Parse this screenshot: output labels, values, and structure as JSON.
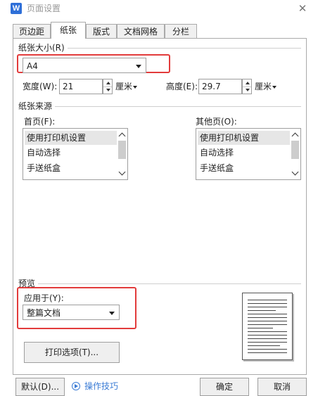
{
  "window": {
    "app_icon_letter": "W",
    "title": "页面设置",
    "close_glyph": "✕"
  },
  "tabs": [
    {
      "label": "页边距",
      "active": false
    },
    {
      "label": "纸张",
      "active": true
    },
    {
      "label": "版式",
      "active": false
    },
    {
      "label": "文档网格",
      "active": false
    },
    {
      "label": "分栏",
      "active": false
    }
  ],
  "paper_size": {
    "section_title": "纸张大小(R)",
    "selected": "A4",
    "width_label": "宽度(W):",
    "width_value": "21",
    "height_label": "高度(E):",
    "height_value": "29.7",
    "unit": "厘米"
  },
  "paper_source": {
    "section_title": "纸张来源",
    "first_page_label": "首页(F):",
    "other_pages_label": "其他页(O):",
    "first_page_options": [
      "使用打印机设置",
      "自动选择",
      "手送纸盒"
    ],
    "other_pages_options": [
      "使用打印机设置",
      "自动选择",
      "手送纸盒"
    ],
    "selected_index": 0
  },
  "preview": {
    "section_title": "预览",
    "apply_to_label": "应用于(Y):",
    "apply_to_value": "整篇文档"
  },
  "buttons": {
    "print_options": "打印选项(T)...",
    "default": "默认(D)...",
    "tips": "操作技巧",
    "ok": "确定",
    "cancel": "取消"
  },
  "colors": {
    "highlight": "#e23b3b",
    "accent": "#3a7bd5",
    "app_icon": "#2e6fd8"
  },
  "icons": {
    "app": "wps-writer-icon",
    "close": "close-icon",
    "tips": "play-circle-icon"
  }
}
